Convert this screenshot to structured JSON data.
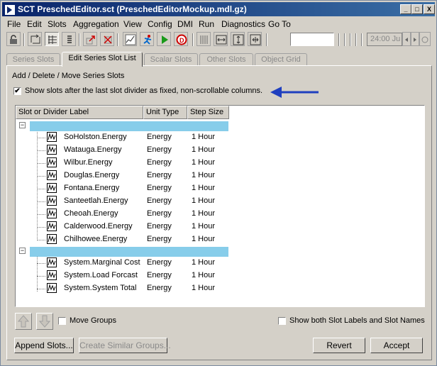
{
  "window": {
    "title": "SCT PreschedEditor.sct (PreschedEditorMockup.mdl.gz)",
    "minimize": "_",
    "maximize": "□",
    "close": "X"
  },
  "menu": [
    "File",
    "Edit",
    "Slots",
    "Aggregation",
    "View",
    "Config",
    "DMI",
    "Run",
    "Diagnostics",
    "Go To"
  ],
  "toolbar": {
    "time_display": "24:00 Ju",
    "icons": [
      "lock-icon",
      "swap-icon",
      "columns-icon",
      "list-icon",
      "open-slot-icon",
      "close-slot-icon",
      "graph-icon",
      "run-figure-icon",
      "play-icon",
      "stop-dmi-icon",
      "vertical-lines-icon",
      "fit-width-icon",
      "fit-height-icon",
      "fit-all-icon"
    ]
  },
  "tabs": [
    {
      "label": "Series Slots",
      "active": false
    },
    {
      "label": "Edit Series Slot List",
      "active": true
    },
    {
      "label": "Scalar Slots",
      "active": false
    },
    {
      "label": "Other Slots",
      "active": false
    },
    {
      "label": "Object Grid",
      "active": false
    }
  ],
  "section_heading": "Add / Delete / Move Series Slots",
  "show_fixed_checkbox": {
    "label": "Show slots after the last slot divider as fixed, non-scrollable columns.",
    "checked_mark": "✔"
  },
  "annotation_arrow_color": "#1f3fbf",
  "table": {
    "columns": [
      "Slot or Divider Label",
      "Unit Type",
      "Step Size"
    ],
    "groups": [
      {
        "expander": "−",
        "divider_color": "#87cdea",
        "rows": [
          {
            "label": "SoHolston.Energy",
            "unit": "Energy",
            "step": "1 Hour"
          },
          {
            "label": "Watauga.Energy",
            "unit": "Energy",
            "step": "1 Hour"
          },
          {
            "label": "Wilbur.Energy",
            "unit": "Energy",
            "step": "1 Hour"
          },
          {
            "label": "Douglas.Energy",
            "unit": "Energy",
            "step": "1 Hour"
          },
          {
            "label": "Fontana.Energy",
            "unit": "Energy",
            "step": "1 Hour"
          },
          {
            "label": "Santeetlah.Energy",
            "unit": "Energy",
            "step": "1 Hour"
          },
          {
            "label": "Cheoah.Energy",
            "unit": "Energy",
            "step": "1 Hour"
          },
          {
            "label": "Calderwood.Energy",
            "unit": "Energy",
            "step": "1 Hour"
          },
          {
            "label": "Chilhowee.Energy",
            "unit": "Energy",
            "step": "1 Hour"
          }
        ]
      },
      {
        "expander": "−",
        "divider_color": "#87cdea",
        "rows": [
          {
            "label": "System.Marginal Cost",
            "unit": "Energy",
            "step": "1 Hour"
          },
          {
            "label": "System.Load Forcast",
            "unit": "Energy",
            "step": "1 Hour"
          },
          {
            "label": "System.System Total",
            "unit": "Energy",
            "step": "1 Hour"
          }
        ]
      }
    ]
  },
  "bottom": {
    "move_groups_label": "Move Groups",
    "show_both_label": "Show both Slot Labels and Slot Names",
    "append_slots": "Append Slots...",
    "create_similar_groups": "Create Similar Groups...",
    "revert": "Revert",
    "accept": "Accept"
  }
}
